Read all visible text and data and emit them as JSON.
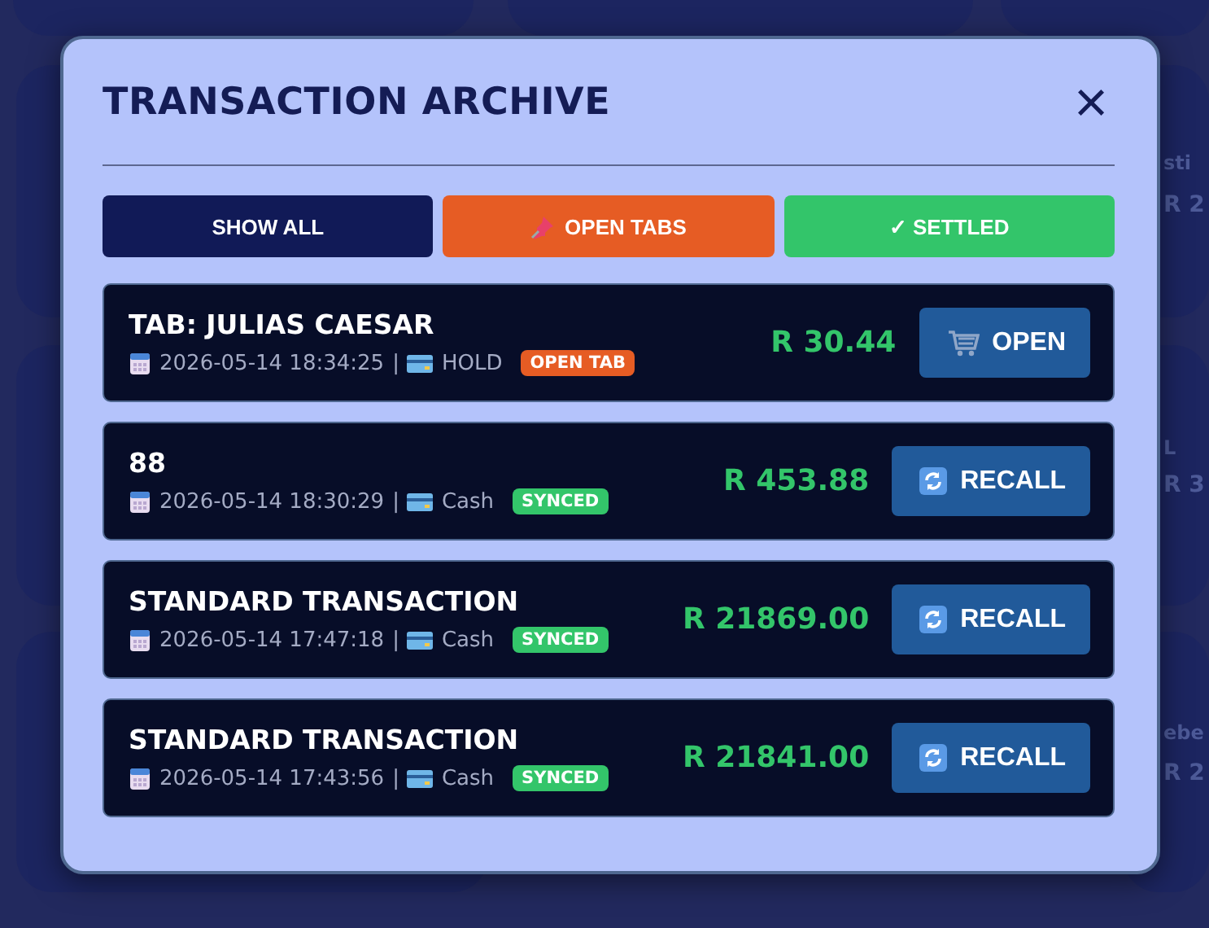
{
  "background_cards": [
    {
      "line_1": "sti",
      "line_2": "R 2"
    },
    {
      "line_1": "L",
      "line_2": "R 3"
    },
    {
      "line_1": "ebe",
      "line_2": "R 2"
    }
  ],
  "dialog": {
    "title": "TRANSACTION ARCHIVE",
    "close": "×"
  },
  "filters": [
    {
      "label": "SHOW ALL",
      "kind": "all",
      "color": "#111a57"
    },
    {
      "label": "OPEN TABS",
      "kind": "pin",
      "color": "#e65c24"
    },
    {
      "label": "✓ SETTLED",
      "kind": "plain",
      "color": "#33c56a"
    }
  ],
  "transactions": [
    {
      "title": "TAB: JULIAS CAESAR",
      "datetime": "2026-05-14 18:34:25",
      "separator": "|",
      "method": "HOLD",
      "badge": {
        "text": "OPEN TAB",
        "color": "#e65c24"
      },
      "amount": "R 30.44",
      "action": {
        "label": "OPEN",
        "kind": "open"
      }
    },
    {
      "title": "88",
      "datetime": "2026-05-14 18:30:29",
      "separator": "|",
      "method": "Cash",
      "badge": {
        "text": "SYNCED",
        "color": "#33c56a"
      },
      "amount": "R 453.88",
      "action": {
        "label": "RECALL",
        "kind": "recall"
      }
    },
    {
      "title": "STANDARD TRANSACTION",
      "datetime": "2026-05-14 17:47:18",
      "separator": "|",
      "method": "Cash",
      "badge": {
        "text": "SYNCED",
        "color": "#33c56a"
      },
      "amount": "R 21869.00",
      "action": {
        "label": "RECALL",
        "kind": "recall"
      }
    },
    {
      "title": "STANDARD TRANSACTION",
      "datetime": "2026-05-14 17:43:56",
      "separator": "|",
      "method": "Cash",
      "badge": {
        "text": "SYNCED",
        "color": "#33c56a"
      },
      "amount": "R 21841.00",
      "action": {
        "label": "RECALL",
        "kind": "recall"
      }
    }
  ]
}
